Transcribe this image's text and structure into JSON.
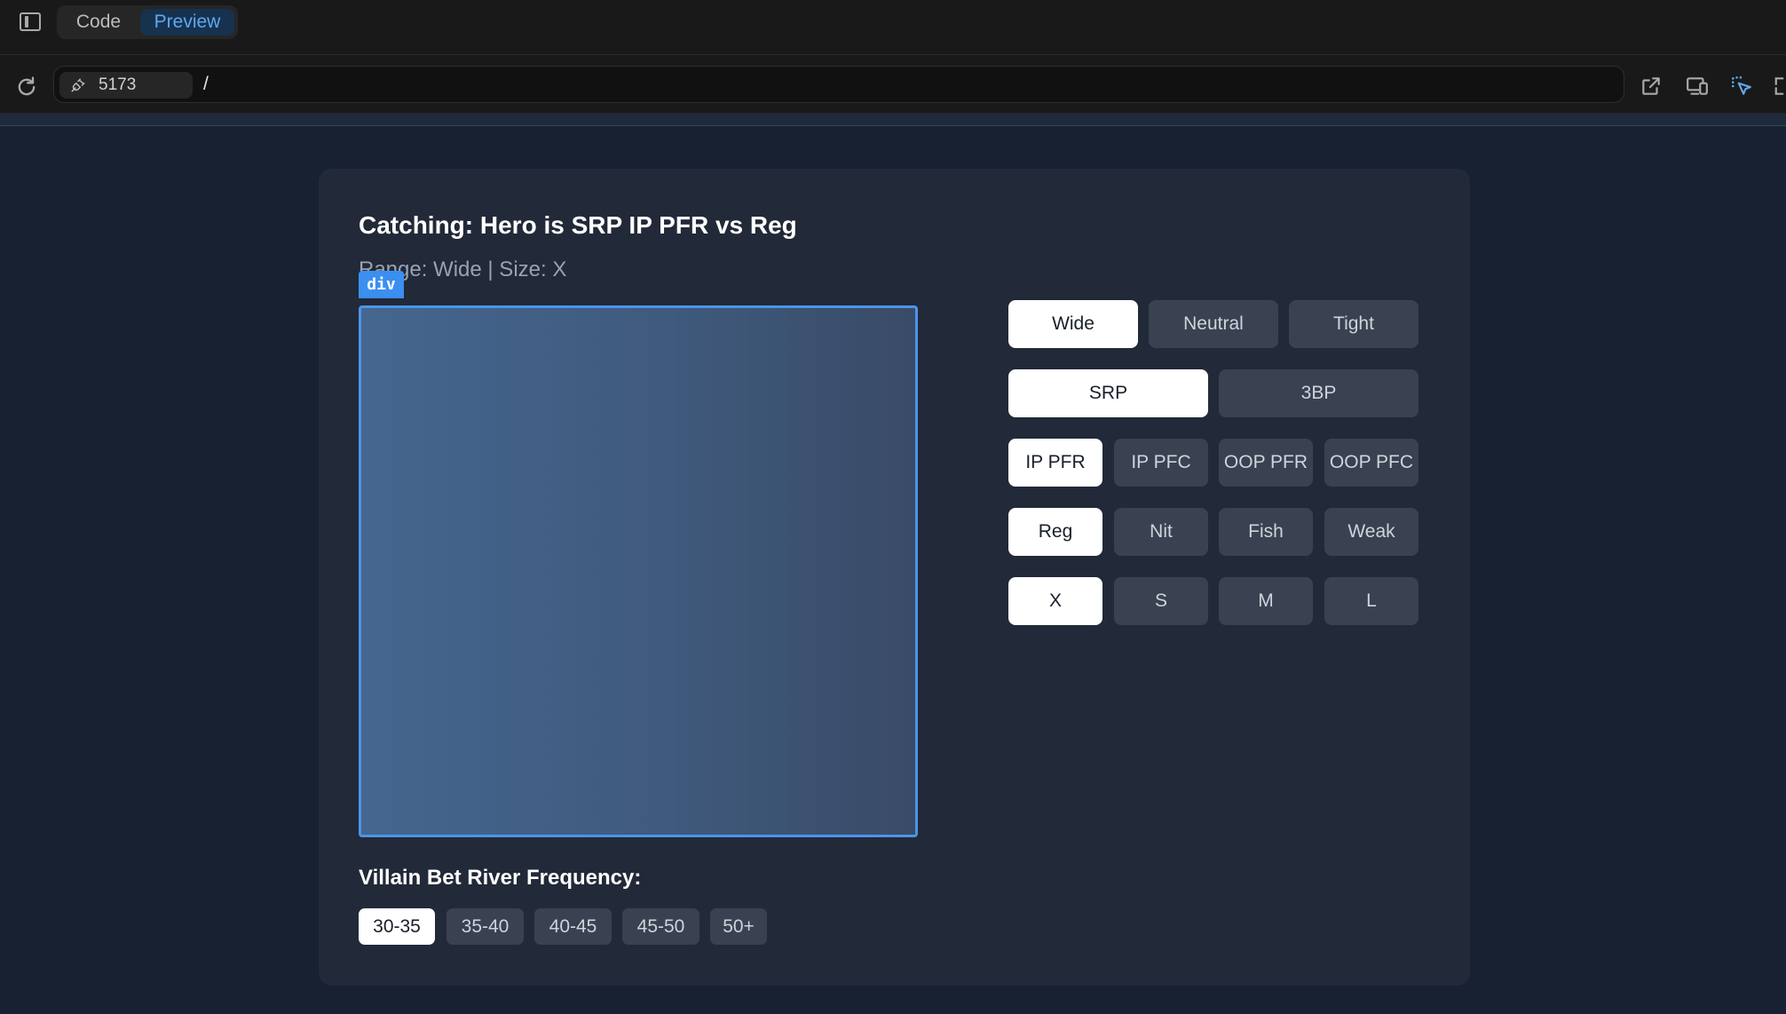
{
  "toolbar": {
    "tabs": [
      {
        "label": "Code",
        "active": false
      },
      {
        "label": "Preview",
        "active": true
      }
    ]
  },
  "addressbar": {
    "port": "5173",
    "path": "/",
    "icons": [
      "reload-icon",
      "plug-icon",
      "open-external-icon",
      "device-preview-icon",
      "element-picker-icon",
      "fullscreen-icon"
    ]
  },
  "card": {
    "title": "Catching: Hero is SRP IP PFR vs Reg",
    "subtitle": "Range: Wide | Size: X",
    "inspect_tag": "div",
    "range_options": [
      "Wide",
      "Neutral",
      "Tight"
    ],
    "pot_options": [
      "SRP",
      "3BP"
    ],
    "position_options": [
      "IP PFR",
      "IP PFC",
      "OOP PFR",
      "OOP PFC"
    ],
    "villain_options": [
      "Reg",
      "Nit",
      "Fish",
      "Weak"
    ],
    "size_options": [
      "X",
      "S",
      "M",
      "L"
    ],
    "frequency_label": "Villain Bet River Frequency:",
    "frequency_options": [
      "30-35",
      "35-40",
      "40-45",
      "45-50",
      "50+"
    ],
    "selected": {
      "range": "Wide",
      "pot": "SRP",
      "position": "IP PFR",
      "villain": "Reg",
      "size": "X",
      "frequency": "30-35"
    }
  },
  "colors": {
    "accent": "#3b8ff0",
    "page_bg": "#172131",
    "card_bg": "#222938",
    "button_bg": "#3a4150",
    "button_active_bg": "#ffffff"
  }
}
